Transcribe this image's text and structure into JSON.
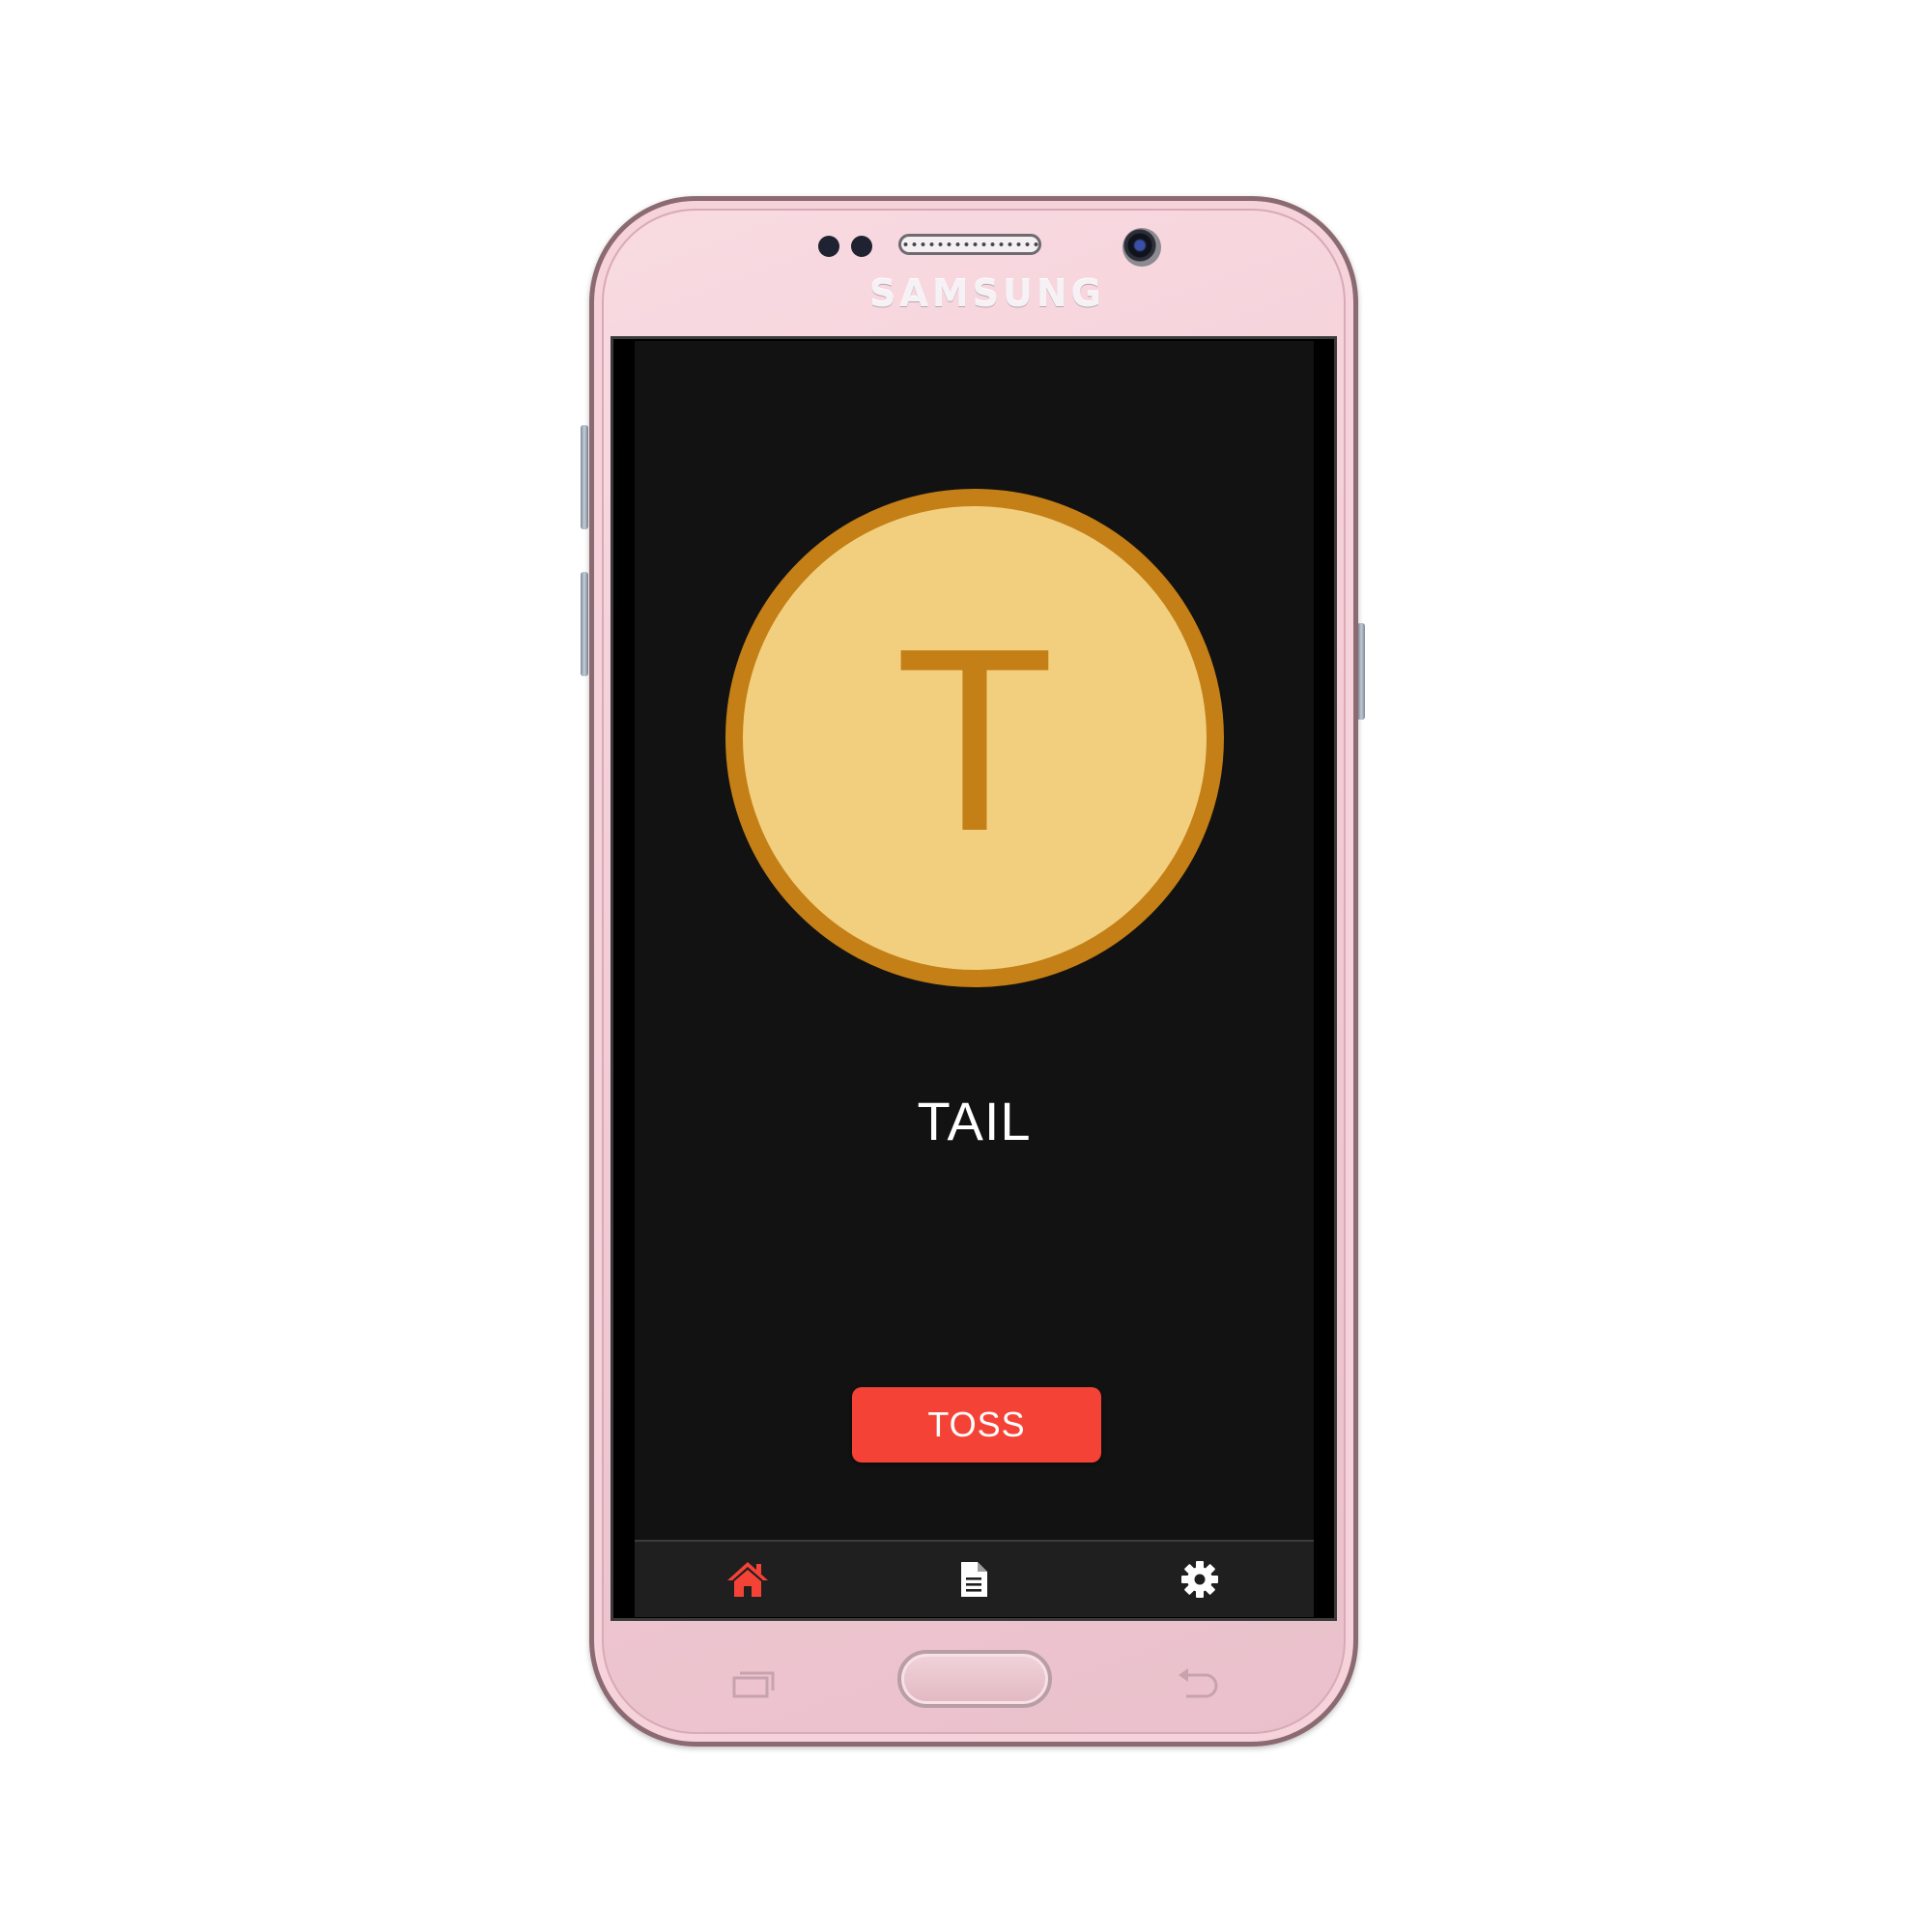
{
  "device": {
    "brand": "SAMSUNG",
    "body_color": "#f3ccd6"
  },
  "app": {
    "coin": {
      "face_letter": "T",
      "fill_color": "#f2cf7e",
      "rim_color": "#c47f16"
    },
    "result_text": "TAIL",
    "toss_button": {
      "label": "TOSS",
      "color": "#f44336"
    },
    "bottom_nav": {
      "items": [
        {
          "icon": "home-icon",
          "active": true,
          "color": "#f44336"
        },
        {
          "icon": "document-icon",
          "active": false,
          "color": "#ffffff"
        },
        {
          "icon": "gear-icon",
          "active": false,
          "color": "#ffffff"
        }
      ]
    }
  },
  "hardware_keys": {
    "recent": "recent-apps-icon",
    "home": "home-key",
    "back": "back-icon"
  }
}
